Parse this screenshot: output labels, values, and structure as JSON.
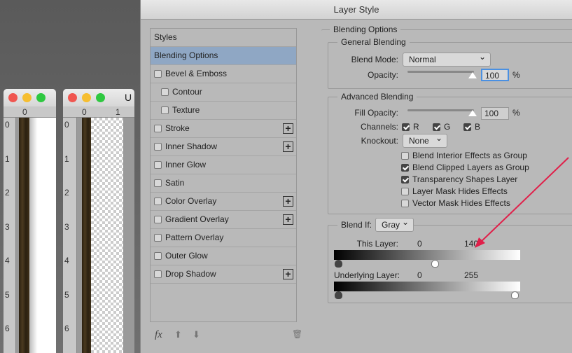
{
  "documents": [
    {
      "ruler_top": [
        "0"
      ],
      "ruler_left": [
        "0",
        "1",
        "2",
        "3",
        "4",
        "5",
        "6"
      ]
    },
    {
      "title_char": "U",
      "ruler_top": [
        "0",
        "1"
      ],
      "ruler_left": [
        "0",
        "1",
        "2",
        "3",
        "4",
        "5",
        "6"
      ]
    }
  ],
  "dialog": {
    "title": "Layer Style",
    "styles_list": [
      {
        "label": "Styles",
        "checkbox": false,
        "selected": false
      },
      {
        "label": "Blending Options",
        "checkbox": false,
        "selected": true
      },
      {
        "label": "Bevel & Emboss",
        "checkbox": true,
        "checked": false
      },
      {
        "label": "Contour",
        "checkbox": true,
        "checked": false,
        "indent": true
      },
      {
        "label": "Texture",
        "checkbox": true,
        "checked": false,
        "indent": true
      },
      {
        "label": "Stroke",
        "checkbox": true,
        "checked": false,
        "plus": true
      },
      {
        "label": "Inner Shadow",
        "checkbox": true,
        "checked": false,
        "plus": true
      },
      {
        "label": "Inner Glow",
        "checkbox": true,
        "checked": false
      },
      {
        "label": "Satin",
        "checkbox": true,
        "checked": false
      },
      {
        "label": "Color Overlay",
        "checkbox": true,
        "checked": false,
        "plus": true
      },
      {
        "label": "Gradient Overlay",
        "checkbox": true,
        "checked": false,
        "plus": true
      },
      {
        "label": "Pattern Overlay",
        "checkbox": true,
        "checked": false
      },
      {
        "label": "Outer Glow",
        "checkbox": true,
        "checked": false
      },
      {
        "label": "Drop Shadow",
        "checkbox": true,
        "checked": false,
        "plus": true
      }
    ],
    "footer": {
      "fx": "fx",
      "up": "⬆",
      "down": "⬇",
      "trash": "🗑"
    },
    "blending": {
      "title": "Blending Options",
      "general": {
        "title": "General Blending",
        "blend_mode_label": "Blend Mode:",
        "blend_mode": "Normal",
        "opacity_label": "Opacity:",
        "opacity": "100",
        "pct": "%"
      },
      "advanced": {
        "title": "Advanced Blending",
        "fill_label": "Fill Opacity:",
        "fill": "100",
        "pct": "%",
        "channels_label": "Channels:",
        "channels": [
          {
            "label": "R",
            "checked": true
          },
          {
            "label": "G",
            "checked": true
          },
          {
            "label": "B",
            "checked": true
          }
        ],
        "knockout_label": "Knockout:",
        "knockout": "None",
        "options": [
          {
            "label": "Blend Interior Effects as Group",
            "checked": false
          },
          {
            "label": "Blend Clipped Layers as Group",
            "checked": true
          },
          {
            "label": "Transparency Shapes Layer",
            "checked": true
          },
          {
            "label": "Layer Mask Hides Effects",
            "checked": false
          },
          {
            "label": "Vector Mask Hides Effects",
            "checked": false
          }
        ]
      },
      "blend_if": {
        "label": "Blend If:",
        "value": "Gray",
        "this_layer_label": "This Layer:",
        "this_min": "0",
        "this_max": "140",
        "underlying_label": "Underlying Layer:",
        "under_min": "0",
        "under_max": "255"
      }
    }
  },
  "colors": {
    "selected": "#8fa7c4",
    "arrow": "#e0204a",
    "focus": "#4a90e2"
  }
}
